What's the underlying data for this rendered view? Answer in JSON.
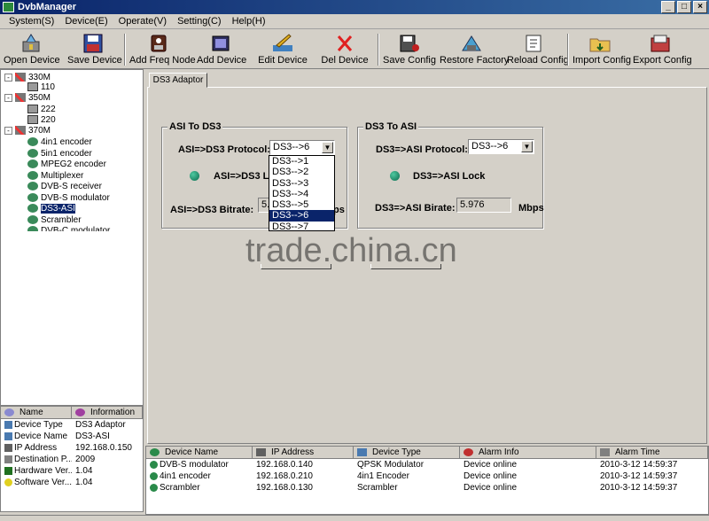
{
  "window": {
    "title": "DvbManager",
    "minimize": "_",
    "maximize": "□",
    "close": "×"
  },
  "menu": [
    "System(S)",
    "Device(E)",
    "Operate(V)",
    "Setting(C)",
    "Help(H)"
  ],
  "toolbar": [
    "Open Device",
    "Save Device",
    "Add Freq Node",
    "Add Device",
    "Edit Device",
    "Del Device",
    "Save Config",
    "Restore Factory",
    "Reload Config",
    "Import Config",
    "Export Config"
  ],
  "tree": {
    "nodes": [
      {
        "label": "330M"
      },
      {
        "label": "110"
      },
      {
        "label": "350M"
      },
      {
        "label": "222"
      },
      {
        "label": "220"
      },
      {
        "label": "370M"
      },
      {
        "label": "4in1 encoder"
      },
      {
        "label": "5in1 encoder"
      },
      {
        "label": "MPEG2 encoder"
      },
      {
        "label": "Multiplexer"
      },
      {
        "label": "DVB-S receiver"
      },
      {
        "label": "DVB-S modulator"
      },
      {
        "label": "DS3-ASI"
      },
      {
        "label": "Scrambler"
      },
      {
        "label": "DVB-C modulator"
      }
    ]
  },
  "info": {
    "headers": [
      "Name",
      "Information"
    ],
    "rows": [
      {
        "k": "Device Type",
        "v": "DS3 Adaptor"
      },
      {
        "k": "Device Name",
        "v": "DS3-ASI"
      },
      {
        "k": "IP Address",
        "v": "192.168.0.150"
      },
      {
        "k": "Destination P...",
        "v": "2009"
      },
      {
        "k": "Hardware Ver...",
        "v": "1.04"
      },
      {
        "k": "Software Ver...",
        "v": "1.04"
      }
    ]
  },
  "tab": {
    "label": "DS3 Adaptor"
  },
  "asi_to_ds3": {
    "title": "ASI To DS3",
    "protocol_label": "ASI=>DS3 Protocol:",
    "protocol_value": "DS3-->6",
    "lock_label": "ASI=>DS3 Lo",
    "bitrate_label": "ASI=>DS3 Bitrate:",
    "bitrate_value": "5.",
    "bitrate_unit": "ps"
  },
  "ds3_to_asi": {
    "title": "DS3 To ASI",
    "protocol_label": "DS3=>ASI Protocol:",
    "protocol_value": "DS3-->6",
    "lock_label": "DS3=>ASI Lock",
    "bitrate_label": "DS3=>ASI Birate:",
    "bitrate_value": "5.976",
    "bitrate_unit": "Mbps"
  },
  "dropdown": {
    "options": [
      "DS3-->1",
      "DS3-->2",
      "DS3-->3",
      "DS3-->4",
      "DS3-->5",
      "DS3-->6",
      "DS3-->7"
    ],
    "selected_index": 5
  },
  "watermark": "trade.china.cn",
  "alarms": {
    "headers": [
      "Device Name",
      "IP Address",
      "Device Type",
      "Alarm Info",
      "Alarm Time"
    ],
    "rows": [
      [
        "DVB-S modulator",
        "192.168.0.140",
        "QPSK Modulator",
        "Device online",
        "2010-3-12 14:59:37"
      ],
      [
        "4in1 encoder",
        "192.168.0.210",
        "4in1 Encoder",
        "Device online",
        "2010-3-12 14:59:37"
      ],
      [
        "Scrambler",
        "192.168.0.130",
        "Scrambler",
        "Device online",
        "2010-3-12 14:59:37"
      ]
    ]
  }
}
